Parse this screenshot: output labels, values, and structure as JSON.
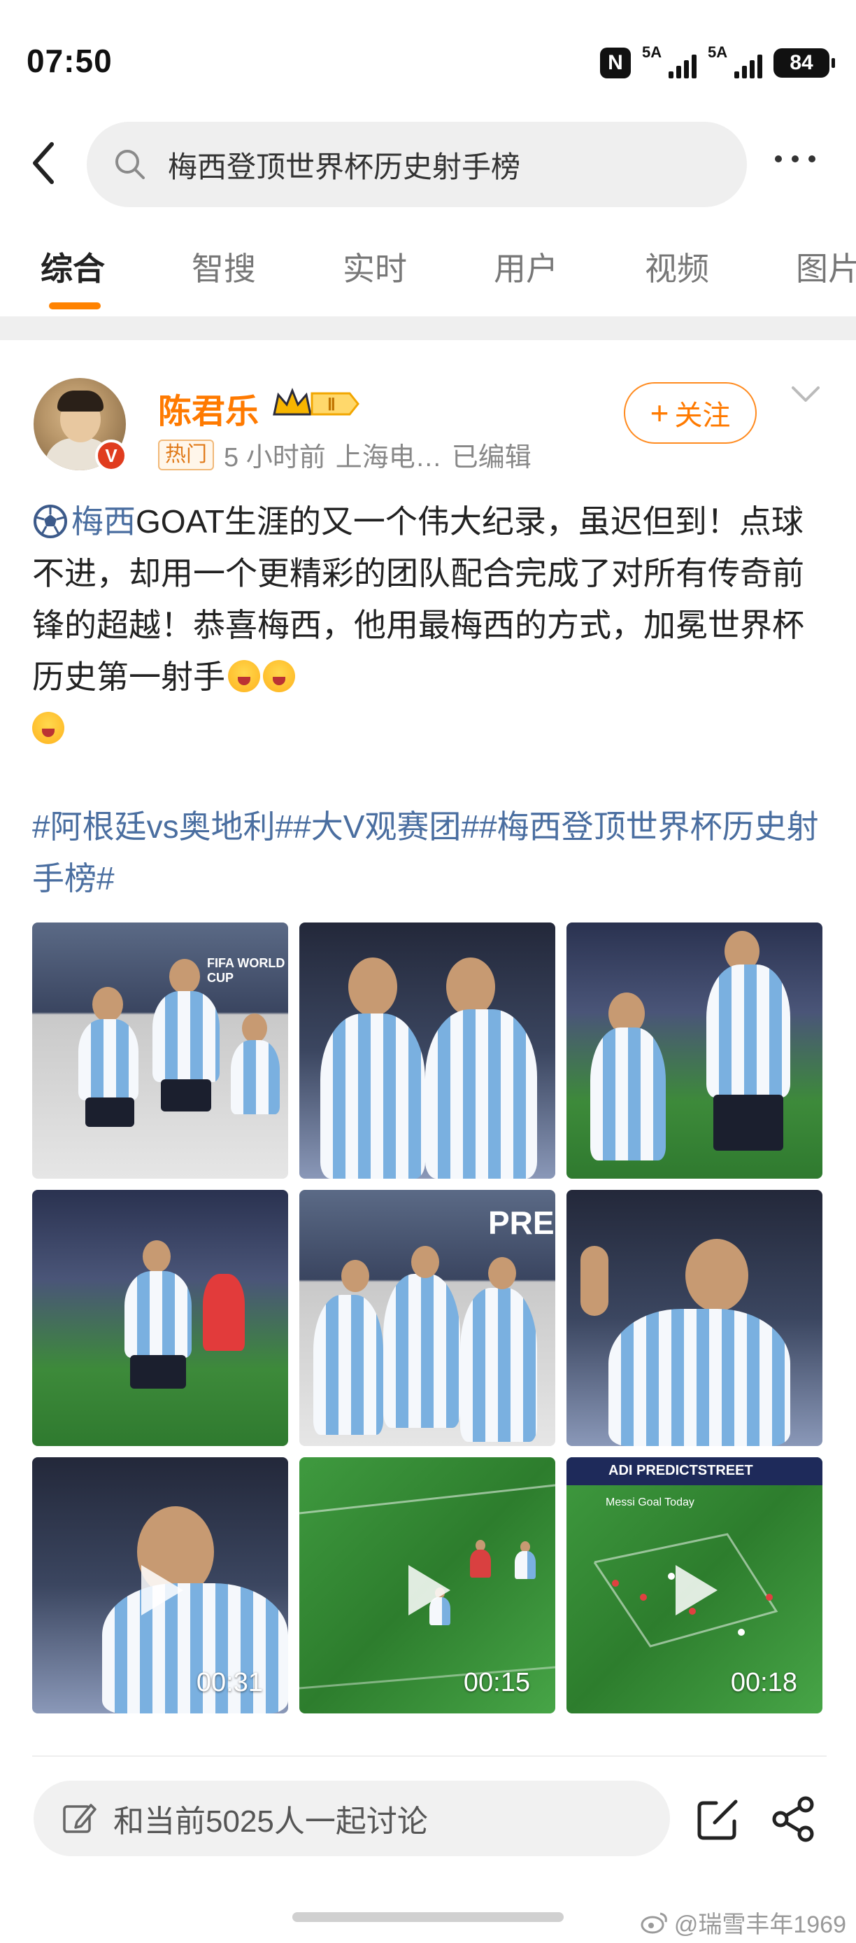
{
  "status_bar": {
    "time": "07:50",
    "nfc_label": "N",
    "signal1_label": "5A",
    "signal2_label": "5A",
    "battery": "84"
  },
  "search": {
    "query": "梅西登顶世界杯历史射手榜"
  },
  "tabs": [
    {
      "label": "综合",
      "active": true
    },
    {
      "label": "智搜",
      "active": false
    },
    {
      "label": "实时",
      "active": false
    },
    {
      "label": "用户",
      "active": false
    },
    {
      "label": "视频",
      "active": false
    },
    {
      "label": "图片",
      "active": false
    }
  ],
  "post": {
    "username": "陈君乐",
    "badge_label": "Ⅱ",
    "verified_label": "V",
    "hot_label": "热门",
    "time": "5 小时前",
    "location": "上海电…",
    "edited": "已编辑",
    "follow_label": "关注",
    "text": {
      "keyword": "梅西",
      "body": "GOAT生涯的又一个伟大纪录，虽迟但到！点球不进，却用一个更精彩的团队配合完成了对所有传奇前锋的超越！恭喜梅西，他用最梅西的方式，加冕世界杯历史第一射手"
    },
    "hashtags": "#阿根廷vs奥地利##大V观赛团##梅西登顶世界杯历史射手榜#",
    "media": [
      {
        "type": "photo",
        "caption": "FIFA WORLD CUP"
      },
      {
        "type": "photo"
      },
      {
        "type": "photo"
      },
      {
        "type": "photo"
      },
      {
        "type": "photo",
        "caption": "PREDI"
      },
      {
        "type": "photo"
      },
      {
        "type": "video",
        "duration": "00:31"
      },
      {
        "type": "video",
        "duration": "00:15"
      },
      {
        "type": "video",
        "duration": "00:18",
        "caption": "ADI PREDICTSTREET",
        "caption2": "Messi Goal Today"
      }
    ]
  },
  "comment_bar": {
    "placeholder": "和当前5025人一起讨论"
  },
  "watermark": "@瑞雪丰年1969",
  "colors": {
    "accent": "#ff8200",
    "username": "#ff7a00",
    "link": "#4a6ea0",
    "keyword": "#eb7350"
  }
}
